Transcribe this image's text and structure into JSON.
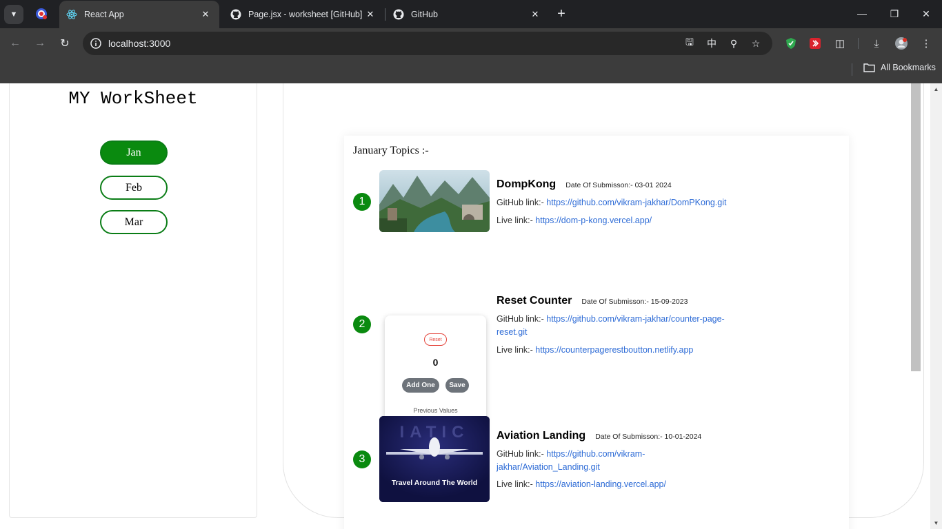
{
  "browser": {
    "tabs": [
      {
        "title": "React App",
        "active": true
      },
      {
        "title": "Page.jsx - worksheet [GitHub] -",
        "active": false
      },
      {
        "title": "GitHub",
        "active": false
      }
    ],
    "url": "localhost:3000",
    "bookmarks_label": "All Bookmarks"
  },
  "sidebar": {
    "title": "MY WorkSheet",
    "months": [
      {
        "label": "Jan",
        "active": true
      },
      {
        "label": "Feb",
        "active": false
      },
      {
        "label": "Mar",
        "active": false
      }
    ]
  },
  "main": {
    "section_title": "January Topics :-",
    "projects": [
      {
        "number": "1",
        "name": "DompKong",
        "date": "Date Of Submisson:- 03-01 2024",
        "github_label": "GitHub link:-",
        "github_url": "https://github.com/vikram-jakhar/DomPKong.git",
        "live_label": "Live link:-",
        "live_url": "https://dom-p-kong.vercel.app/"
      },
      {
        "number": "2",
        "name": "Reset Counter",
        "date": "Date Of Submisson:- 15-09-2023",
        "github_label": "GitHub link:-",
        "github_url": "https://github.com/vikram-jakhar/counter-page-reset.git",
        "live_label": "Live link:-",
        "live_url": "https://counterpagerestboutton.netlify.app"
      },
      {
        "number": "3",
        "name": "Aviation Landing",
        "date": "Date Of Submisson:- 10-01-2024",
        "github_label": "GitHub link:-",
        "github_url": "https://github.com/vikram-jakhar/Aviation_Landing.git",
        "live_label": "Live link:-",
        "live_url": "https://aviation-landing.vercel.app/"
      }
    ],
    "counter_preview": {
      "reset_label": "Reset",
      "value": "0",
      "add_label": "Add One",
      "save_label": "Save",
      "previous_label": "Previous Values"
    },
    "aviation_preview": {
      "bg_text": "IATIC",
      "caption": "Travel Around The World"
    }
  }
}
